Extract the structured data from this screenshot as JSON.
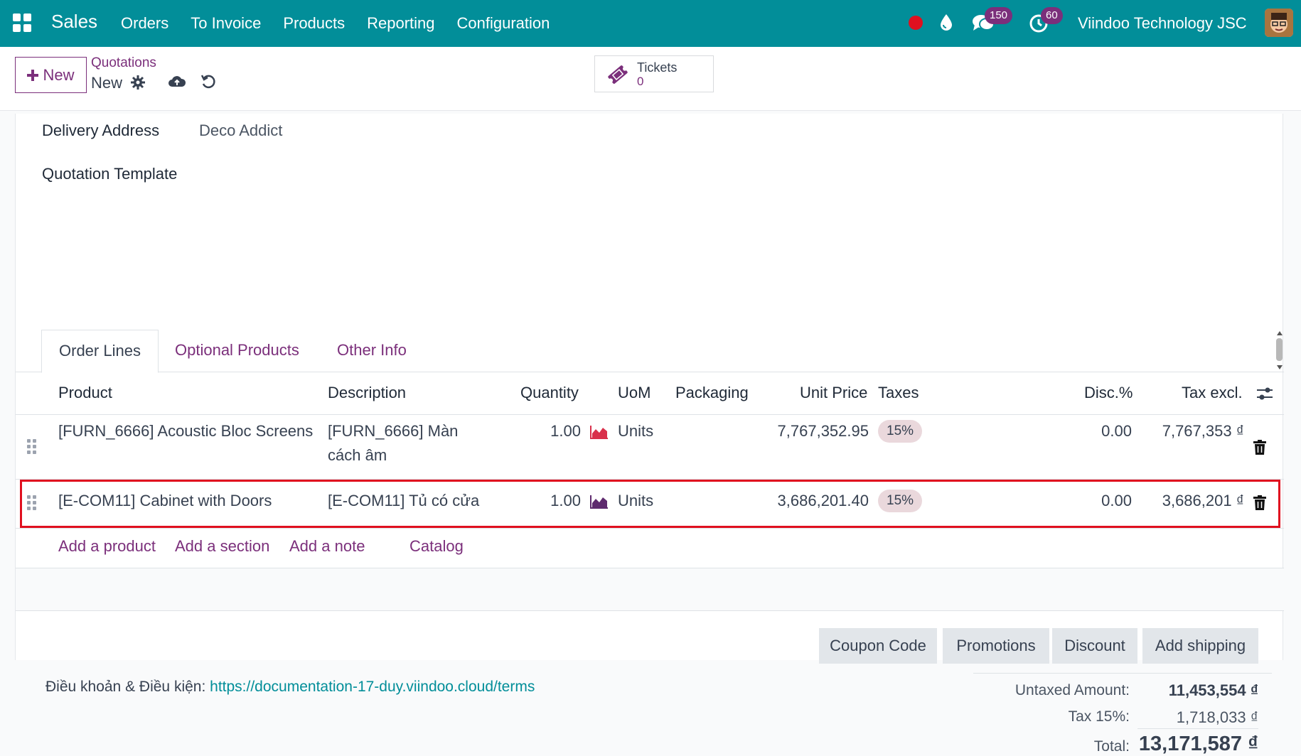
{
  "topbar": {
    "app_name": "Sales",
    "menu": [
      "Orders",
      "To Invoice",
      "Products",
      "Reporting",
      "Configuration"
    ],
    "messages_count": "150",
    "activities_count": "60",
    "company": "Viindoo Technology JSC",
    "bar_color": "#028e99"
  },
  "control_panel": {
    "new_label": "New",
    "breadcrumb_parent": "Quotations",
    "breadcrumb_current": "New",
    "tickets_label": "Tickets",
    "tickets_count": "0"
  },
  "form": {
    "delivery_address_label": "Delivery Address",
    "delivery_address_value": "Deco Addict",
    "quotation_template_label": "Quotation Template"
  },
  "tabs": [
    "Order Lines",
    "Optional Products",
    "Other Info"
  ],
  "order_lines": {
    "columns": [
      "Product",
      "Description",
      "Quantity",
      "UoM",
      "Packaging",
      "Unit Price",
      "Taxes",
      "Disc.%",
      "Tax excl."
    ],
    "rows": [
      {
        "product": "[FURN_6666] Acoustic Bloc Screens",
        "description_line1": "[FURN_6666] Màn",
        "description_line2": "cách âm",
        "quantity": "1.00",
        "uom": "Units",
        "unit_price": "7,767,352.95",
        "taxes": "15%",
        "discount": "0.00",
        "subtotal": "7,767,353 ₫"
      },
      {
        "product": "[E-COM11] Cabinet with Doors",
        "description_line1": "[E-COM11] Tủ có cửa",
        "description_line2": "",
        "quantity": "1.00",
        "uom": "Units",
        "unit_price": "3,686,201.40",
        "taxes": "15%",
        "discount": "0.00",
        "subtotal": "3,686,201 ₫"
      }
    ],
    "add_links": [
      "Add a product",
      "Add a section",
      "Add a note",
      "Catalog"
    ]
  },
  "promo_buttons": [
    "Coupon Code",
    "Promotions",
    "Discount",
    "Add shipping"
  ],
  "terms": {
    "label": "Điều khoản & Điều kiện:",
    "link": "https://documentation-17-duy.viindoo.cloud/terms"
  },
  "totals": {
    "untaxed_label": "Untaxed Amount:",
    "untaxed_value": "11,453,554 ₫",
    "tax_label": "Tax 15%:",
    "tax_value": "1,718,033 ₫",
    "total_label": "Total:",
    "total_value": "13,171,587 ₫"
  }
}
